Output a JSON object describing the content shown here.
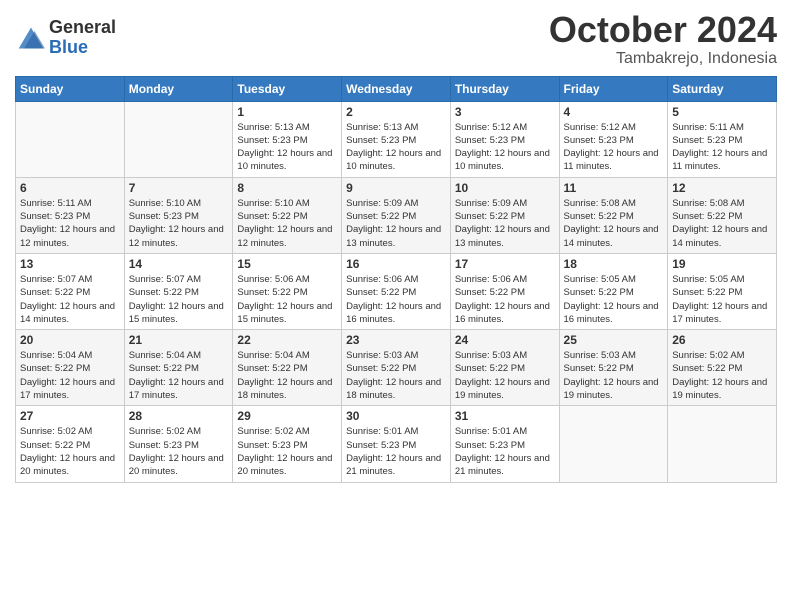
{
  "logo": {
    "general": "General",
    "blue": "Blue"
  },
  "title": "October 2024",
  "subtitle": "Tambakrejo, Indonesia",
  "header_days": [
    "Sunday",
    "Monday",
    "Tuesday",
    "Wednesday",
    "Thursday",
    "Friday",
    "Saturday"
  ],
  "weeks": [
    [
      {
        "day": "",
        "sunrise": "",
        "sunset": "",
        "daylight": ""
      },
      {
        "day": "",
        "sunrise": "",
        "sunset": "",
        "daylight": ""
      },
      {
        "day": "1",
        "sunrise": "Sunrise: 5:13 AM",
        "sunset": "Sunset: 5:23 PM",
        "daylight": "Daylight: 12 hours and 10 minutes."
      },
      {
        "day": "2",
        "sunrise": "Sunrise: 5:13 AM",
        "sunset": "Sunset: 5:23 PM",
        "daylight": "Daylight: 12 hours and 10 minutes."
      },
      {
        "day": "3",
        "sunrise": "Sunrise: 5:12 AM",
        "sunset": "Sunset: 5:23 PM",
        "daylight": "Daylight: 12 hours and 10 minutes."
      },
      {
        "day": "4",
        "sunrise": "Sunrise: 5:12 AM",
        "sunset": "Sunset: 5:23 PM",
        "daylight": "Daylight: 12 hours and 11 minutes."
      },
      {
        "day": "5",
        "sunrise": "Sunrise: 5:11 AM",
        "sunset": "Sunset: 5:23 PM",
        "daylight": "Daylight: 12 hours and 11 minutes."
      }
    ],
    [
      {
        "day": "6",
        "sunrise": "Sunrise: 5:11 AM",
        "sunset": "Sunset: 5:23 PM",
        "daylight": "Daylight: 12 hours and 12 minutes."
      },
      {
        "day": "7",
        "sunrise": "Sunrise: 5:10 AM",
        "sunset": "Sunset: 5:23 PM",
        "daylight": "Daylight: 12 hours and 12 minutes."
      },
      {
        "day": "8",
        "sunrise": "Sunrise: 5:10 AM",
        "sunset": "Sunset: 5:22 PM",
        "daylight": "Daylight: 12 hours and 12 minutes."
      },
      {
        "day": "9",
        "sunrise": "Sunrise: 5:09 AM",
        "sunset": "Sunset: 5:22 PM",
        "daylight": "Daylight: 12 hours and 13 minutes."
      },
      {
        "day": "10",
        "sunrise": "Sunrise: 5:09 AM",
        "sunset": "Sunset: 5:22 PM",
        "daylight": "Daylight: 12 hours and 13 minutes."
      },
      {
        "day": "11",
        "sunrise": "Sunrise: 5:08 AM",
        "sunset": "Sunset: 5:22 PM",
        "daylight": "Daylight: 12 hours and 14 minutes."
      },
      {
        "day": "12",
        "sunrise": "Sunrise: 5:08 AM",
        "sunset": "Sunset: 5:22 PM",
        "daylight": "Daylight: 12 hours and 14 minutes."
      }
    ],
    [
      {
        "day": "13",
        "sunrise": "Sunrise: 5:07 AM",
        "sunset": "Sunset: 5:22 PM",
        "daylight": "Daylight: 12 hours and 14 minutes."
      },
      {
        "day": "14",
        "sunrise": "Sunrise: 5:07 AM",
        "sunset": "Sunset: 5:22 PM",
        "daylight": "Daylight: 12 hours and 15 minutes."
      },
      {
        "day": "15",
        "sunrise": "Sunrise: 5:06 AM",
        "sunset": "Sunset: 5:22 PM",
        "daylight": "Daylight: 12 hours and 15 minutes."
      },
      {
        "day": "16",
        "sunrise": "Sunrise: 5:06 AM",
        "sunset": "Sunset: 5:22 PM",
        "daylight": "Daylight: 12 hours and 16 minutes."
      },
      {
        "day": "17",
        "sunrise": "Sunrise: 5:06 AM",
        "sunset": "Sunset: 5:22 PM",
        "daylight": "Daylight: 12 hours and 16 minutes."
      },
      {
        "day": "18",
        "sunrise": "Sunrise: 5:05 AM",
        "sunset": "Sunset: 5:22 PM",
        "daylight": "Daylight: 12 hours and 16 minutes."
      },
      {
        "day": "19",
        "sunrise": "Sunrise: 5:05 AM",
        "sunset": "Sunset: 5:22 PM",
        "daylight": "Daylight: 12 hours and 17 minutes."
      }
    ],
    [
      {
        "day": "20",
        "sunrise": "Sunrise: 5:04 AM",
        "sunset": "Sunset: 5:22 PM",
        "daylight": "Daylight: 12 hours and 17 minutes."
      },
      {
        "day": "21",
        "sunrise": "Sunrise: 5:04 AM",
        "sunset": "Sunset: 5:22 PM",
        "daylight": "Daylight: 12 hours and 17 minutes."
      },
      {
        "day": "22",
        "sunrise": "Sunrise: 5:04 AM",
        "sunset": "Sunset: 5:22 PM",
        "daylight": "Daylight: 12 hours and 18 minutes."
      },
      {
        "day": "23",
        "sunrise": "Sunrise: 5:03 AM",
        "sunset": "Sunset: 5:22 PM",
        "daylight": "Daylight: 12 hours and 18 minutes."
      },
      {
        "day": "24",
        "sunrise": "Sunrise: 5:03 AM",
        "sunset": "Sunset: 5:22 PM",
        "daylight": "Daylight: 12 hours and 19 minutes."
      },
      {
        "day": "25",
        "sunrise": "Sunrise: 5:03 AM",
        "sunset": "Sunset: 5:22 PM",
        "daylight": "Daylight: 12 hours and 19 minutes."
      },
      {
        "day": "26",
        "sunrise": "Sunrise: 5:02 AM",
        "sunset": "Sunset: 5:22 PM",
        "daylight": "Daylight: 12 hours and 19 minutes."
      }
    ],
    [
      {
        "day": "27",
        "sunrise": "Sunrise: 5:02 AM",
        "sunset": "Sunset: 5:22 PM",
        "daylight": "Daylight: 12 hours and 20 minutes."
      },
      {
        "day": "28",
        "sunrise": "Sunrise: 5:02 AM",
        "sunset": "Sunset: 5:23 PM",
        "daylight": "Daylight: 12 hours and 20 minutes."
      },
      {
        "day": "29",
        "sunrise": "Sunrise: 5:02 AM",
        "sunset": "Sunset: 5:23 PM",
        "daylight": "Daylight: 12 hours and 20 minutes."
      },
      {
        "day": "30",
        "sunrise": "Sunrise: 5:01 AM",
        "sunset": "Sunset: 5:23 PM",
        "daylight": "Daylight: 12 hours and 21 minutes."
      },
      {
        "day": "31",
        "sunrise": "Sunrise: 5:01 AM",
        "sunset": "Sunset: 5:23 PM",
        "daylight": "Daylight: 12 hours and 21 minutes."
      },
      {
        "day": "",
        "sunrise": "",
        "sunset": "",
        "daylight": ""
      },
      {
        "day": "",
        "sunrise": "",
        "sunset": "",
        "daylight": ""
      }
    ]
  ]
}
